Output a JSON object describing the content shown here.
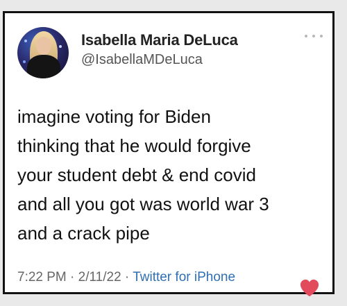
{
  "tweet": {
    "display_name": "Isabella Maria DeLuca",
    "handle": "@IsabellaMDeLuca",
    "text": "imagine voting for Biden\nthinking that he would forgive\nyour student debt & end covid\nand all you got was world war 3\nand a crack pipe",
    "time": "7:22 PM",
    "separator": "·",
    "date": "2/11/22",
    "source": "Twitter for iPhone"
  },
  "icons": {
    "more": "more-options-icon",
    "like": "heart-icon"
  },
  "colors": {
    "source_link": "#2f6fb2",
    "heart": "#e24b5b"
  }
}
